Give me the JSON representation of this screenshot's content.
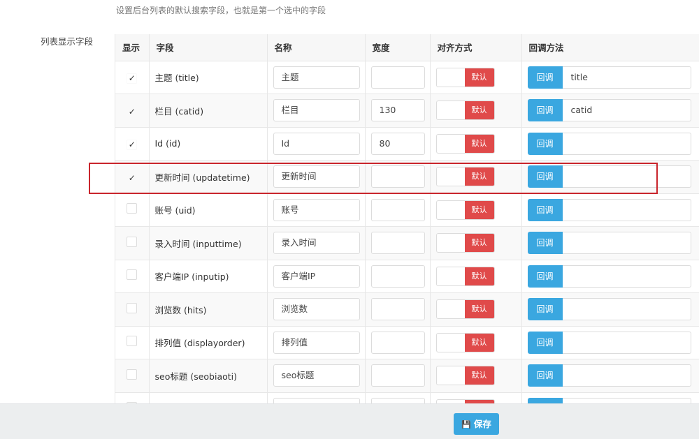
{
  "hint": "设置后台列表的默认搜索字段，也就是第一个选中的字段",
  "section_label": "列表显示字段",
  "columns": [
    "显示",
    "字段",
    "名称",
    "宽度",
    "对齐方式",
    "回调方法"
  ],
  "default_label": "默认",
  "callback_label": "回调",
  "save_label": "保存",
  "colors": {
    "accent": "#3aa7e0",
    "danger": "#e04a4a",
    "highlight": "#c9252c"
  },
  "rows": [
    {
      "checked": true,
      "field": "主题 (title)",
      "name": "主题",
      "width": "",
      "callback": "title"
    },
    {
      "checked": true,
      "field": "栏目 (catid)",
      "name": "栏目",
      "width": "130",
      "callback": "catid"
    },
    {
      "checked": true,
      "field": "Id (id)",
      "name": "Id",
      "width": "80",
      "callback": ""
    },
    {
      "checked": true,
      "field": "更新时间 (updatetime)",
      "name": "更新时间",
      "width": "",
      "callback": ""
    },
    {
      "checked": false,
      "field": "账号 (uid)",
      "name": "账号",
      "width": "",
      "callback": ""
    },
    {
      "checked": false,
      "field": "录入时间 (inputtime)",
      "name": "录入时间",
      "width": "",
      "callback": ""
    },
    {
      "checked": false,
      "field": "客户端IP (inputip)",
      "name": "客户端IP",
      "width": "",
      "callback": ""
    },
    {
      "checked": false,
      "field": "浏览数 (hits)",
      "name": "浏览数",
      "width": "",
      "callback": ""
    },
    {
      "checked": false,
      "field": "排列值 (displayorder)",
      "name": "排列值",
      "width": "",
      "callback": ""
    },
    {
      "checked": false,
      "field": "seo标题 (seobiaoti)",
      "name": "seo标题",
      "width": "",
      "callback": ""
    },
    {
      "checked": false,
      "field": "",
      "name": "",
      "width": "",
      "callback": ""
    }
  ]
}
